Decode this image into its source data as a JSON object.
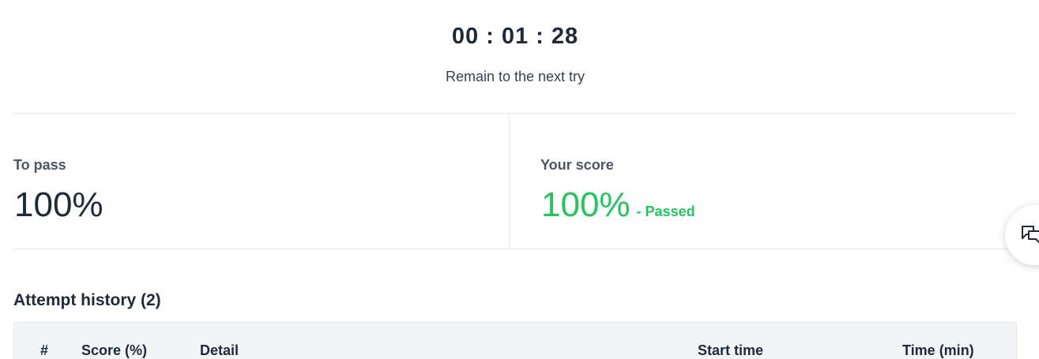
{
  "timer": {
    "value": "00 : 01 : 28",
    "caption": "Remain to the next try"
  },
  "stats": {
    "pass_label": "To pass",
    "pass_value": "100%",
    "score_label": "Your score",
    "score_value": "100%",
    "score_status": "- Passed"
  },
  "history": {
    "title": "Attempt history (2)",
    "columns": [
      "#",
      "Score (%)",
      "Detail",
      "Start time",
      "Time (min)"
    ]
  },
  "icons": {
    "chat": "chat-bubbles-icon"
  },
  "colors": {
    "passed": "#22c55e",
    "text": "#1f2937",
    "table_header_bg": "#f3f4f6"
  }
}
